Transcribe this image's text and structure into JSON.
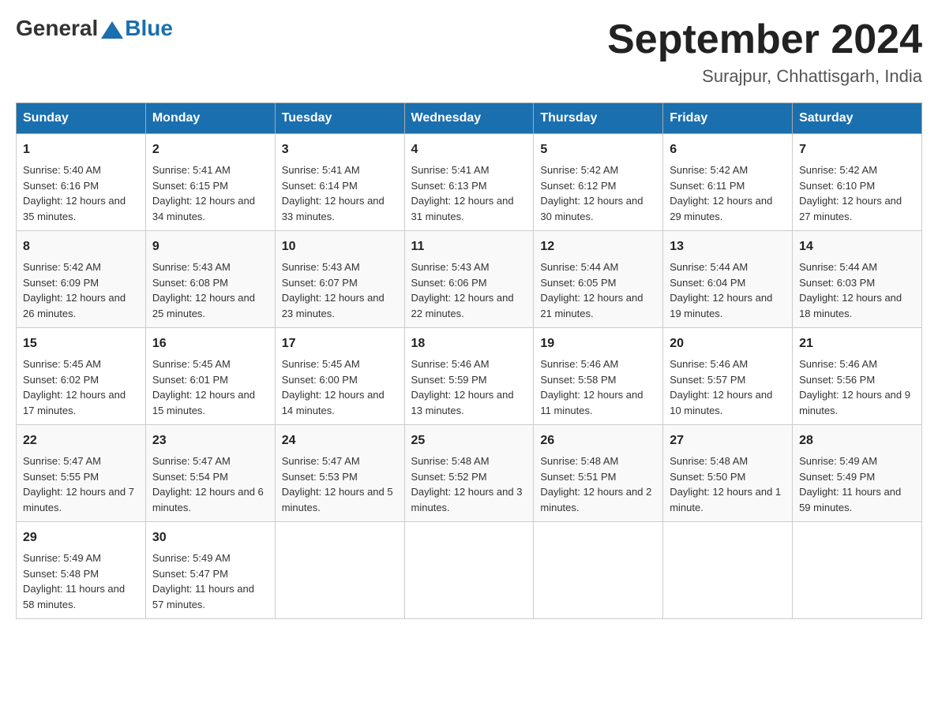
{
  "header": {
    "logo": {
      "general": "General",
      "triangle": "▲",
      "blue": "Blue"
    },
    "title": "September 2024",
    "subtitle": "Surajpur, Chhattisgarh, India"
  },
  "weekdays": [
    "Sunday",
    "Monday",
    "Tuesday",
    "Wednesday",
    "Thursday",
    "Friday",
    "Saturday"
  ],
  "rows": [
    [
      {
        "day": "1",
        "sunrise": "5:40 AM",
        "sunset": "6:16 PM",
        "daylight": "12 hours and 35 minutes."
      },
      {
        "day": "2",
        "sunrise": "5:41 AM",
        "sunset": "6:15 PM",
        "daylight": "12 hours and 34 minutes."
      },
      {
        "day": "3",
        "sunrise": "5:41 AM",
        "sunset": "6:14 PM",
        "daylight": "12 hours and 33 minutes."
      },
      {
        "day": "4",
        "sunrise": "5:41 AM",
        "sunset": "6:13 PM",
        "daylight": "12 hours and 31 minutes."
      },
      {
        "day": "5",
        "sunrise": "5:42 AM",
        "sunset": "6:12 PM",
        "daylight": "12 hours and 30 minutes."
      },
      {
        "day": "6",
        "sunrise": "5:42 AM",
        "sunset": "6:11 PM",
        "daylight": "12 hours and 29 minutes."
      },
      {
        "day": "7",
        "sunrise": "5:42 AM",
        "sunset": "6:10 PM",
        "daylight": "12 hours and 27 minutes."
      }
    ],
    [
      {
        "day": "8",
        "sunrise": "5:42 AM",
        "sunset": "6:09 PM",
        "daylight": "12 hours and 26 minutes."
      },
      {
        "day": "9",
        "sunrise": "5:43 AM",
        "sunset": "6:08 PM",
        "daylight": "12 hours and 25 minutes."
      },
      {
        "day": "10",
        "sunrise": "5:43 AM",
        "sunset": "6:07 PM",
        "daylight": "12 hours and 23 minutes."
      },
      {
        "day": "11",
        "sunrise": "5:43 AM",
        "sunset": "6:06 PM",
        "daylight": "12 hours and 22 minutes."
      },
      {
        "day": "12",
        "sunrise": "5:44 AM",
        "sunset": "6:05 PM",
        "daylight": "12 hours and 21 minutes."
      },
      {
        "day": "13",
        "sunrise": "5:44 AM",
        "sunset": "6:04 PM",
        "daylight": "12 hours and 19 minutes."
      },
      {
        "day": "14",
        "sunrise": "5:44 AM",
        "sunset": "6:03 PM",
        "daylight": "12 hours and 18 minutes."
      }
    ],
    [
      {
        "day": "15",
        "sunrise": "5:45 AM",
        "sunset": "6:02 PM",
        "daylight": "12 hours and 17 minutes."
      },
      {
        "day": "16",
        "sunrise": "5:45 AM",
        "sunset": "6:01 PM",
        "daylight": "12 hours and 15 minutes."
      },
      {
        "day": "17",
        "sunrise": "5:45 AM",
        "sunset": "6:00 PM",
        "daylight": "12 hours and 14 minutes."
      },
      {
        "day": "18",
        "sunrise": "5:46 AM",
        "sunset": "5:59 PM",
        "daylight": "12 hours and 13 minutes."
      },
      {
        "day": "19",
        "sunrise": "5:46 AM",
        "sunset": "5:58 PM",
        "daylight": "12 hours and 11 minutes."
      },
      {
        "day": "20",
        "sunrise": "5:46 AM",
        "sunset": "5:57 PM",
        "daylight": "12 hours and 10 minutes."
      },
      {
        "day": "21",
        "sunrise": "5:46 AM",
        "sunset": "5:56 PM",
        "daylight": "12 hours and 9 minutes."
      }
    ],
    [
      {
        "day": "22",
        "sunrise": "5:47 AM",
        "sunset": "5:55 PM",
        "daylight": "12 hours and 7 minutes."
      },
      {
        "day": "23",
        "sunrise": "5:47 AM",
        "sunset": "5:54 PM",
        "daylight": "12 hours and 6 minutes."
      },
      {
        "day": "24",
        "sunrise": "5:47 AM",
        "sunset": "5:53 PM",
        "daylight": "12 hours and 5 minutes."
      },
      {
        "day": "25",
        "sunrise": "5:48 AM",
        "sunset": "5:52 PM",
        "daylight": "12 hours and 3 minutes."
      },
      {
        "day": "26",
        "sunrise": "5:48 AM",
        "sunset": "5:51 PM",
        "daylight": "12 hours and 2 minutes."
      },
      {
        "day": "27",
        "sunrise": "5:48 AM",
        "sunset": "5:50 PM",
        "daylight": "12 hours and 1 minute."
      },
      {
        "day": "28",
        "sunrise": "5:49 AM",
        "sunset": "5:49 PM",
        "daylight": "11 hours and 59 minutes."
      }
    ],
    [
      {
        "day": "29",
        "sunrise": "5:49 AM",
        "sunset": "5:48 PM",
        "daylight": "11 hours and 58 minutes."
      },
      {
        "day": "30",
        "sunrise": "5:49 AM",
        "sunset": "5:47 PM",
        "daylight": "11 hours and 57 minutes."
      },
      null,
      null,
      null,
      null,
      null
    ]
  ]
}
